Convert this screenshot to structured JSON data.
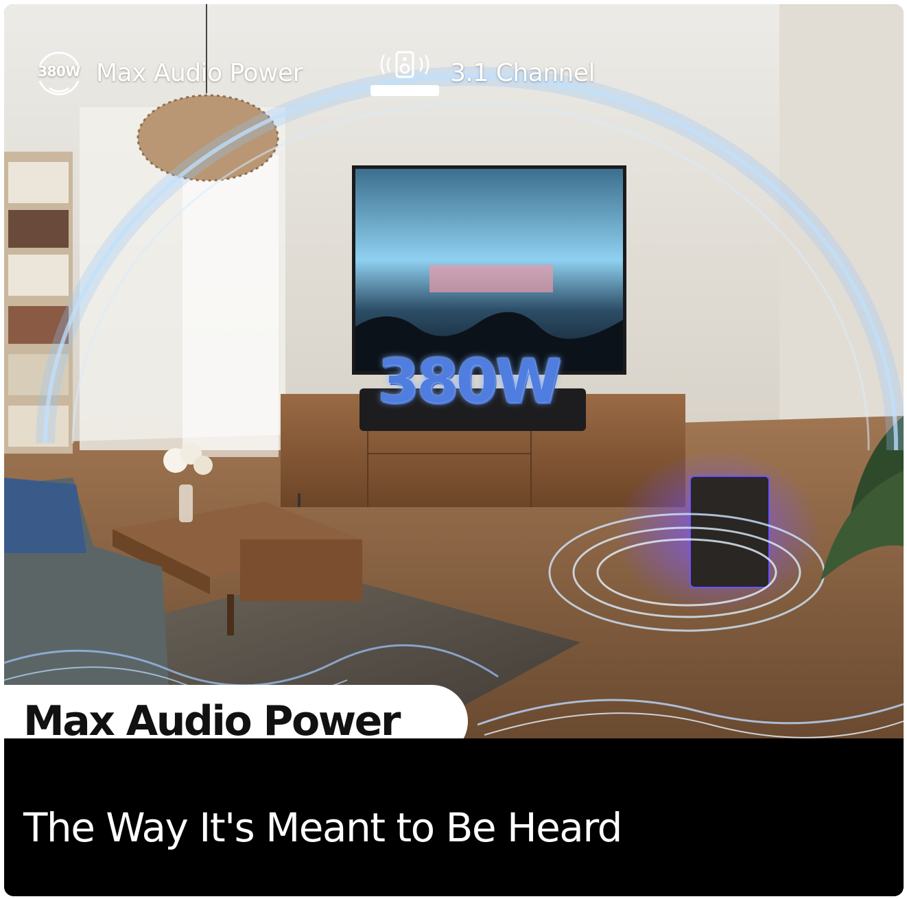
{
  "features": {
    "power": {
      "badge_text": "380W",
      "label": "Max Audio Power",
      "icon": "power-badge-icon"
    },
    "channel": {
      "label": "3.1 Channel",
      "icon": "soundbar-speaker-icon"
    }
  },
  "scene": {
    "overlay_text": "380W",
    "description_icons": [
      "tv-screen",
      "soundbar",
      "subwoofer",
      "coffee-table",
      "pendant-lamp",
      "bookshelf",
      "sofa",
      "plant"
    ]
  },
  "headline": "Max Audio Power",
  "tagline": "The Way It's Meant to Be Heard",
  "colors": {
    "glow_blue": "#8fc4ff",
    "accent_purple": "#6a4cff",
    "band": "#000000"
  }
}
